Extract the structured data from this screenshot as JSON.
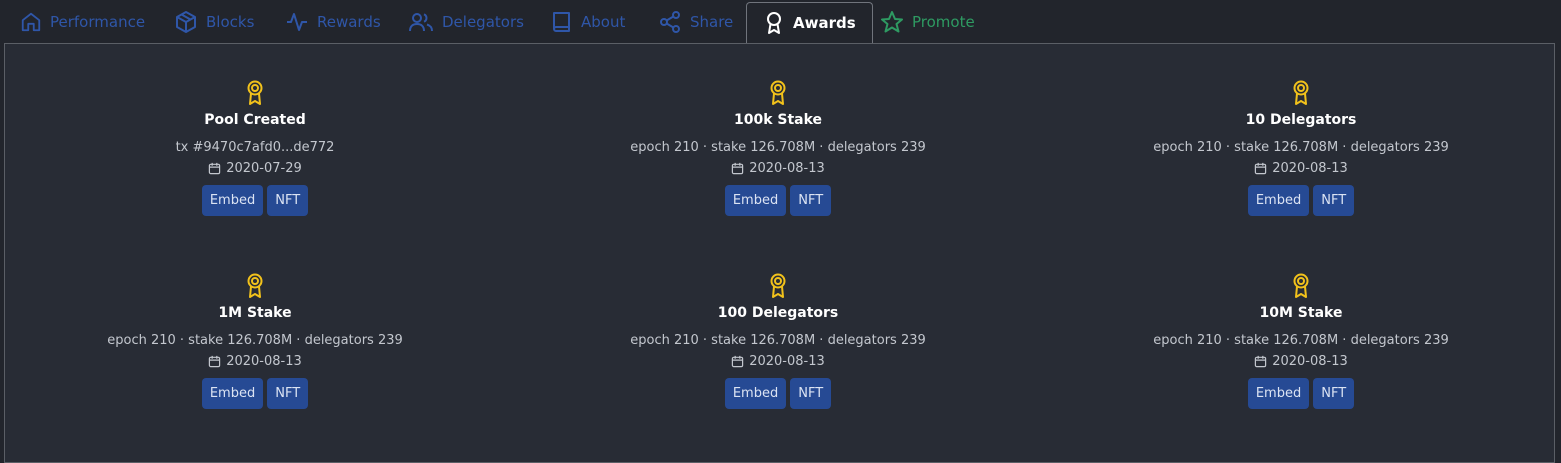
{
  "tabs": [
    {
      "label": "Performance",
      "icon": "home-icon"
    },
    {
      "label": "Blocks",
      "icon": "cube-icon"
    },
    {
      "label": "Rewards",
      "icon": "activity-icon"
    },
    {
      "label": "Delegators",
      "icon": "users-icon"
    },
    {
      "label": "About",
      "icon": "book-icon"
    },
    {
      "label": "Share",
      "icon": "share-icon"
    },
    {
      "label": "Awards",
      "icon": "award-icon",
      "active": true
    },
    {
      "label": "Promote",
      "icon": "star-icon"
    }
  ],
  "colors": {
    "tab_text": "#2f56a8",
    "promote": "#2e9a62",
    "medal": "#f2c21b",
    "button_bg": "#264a94",
    "background": "#22252c"
  },
  "awards": [
    {
      "title": "Pool Created",
      "meta": "tx #9470c7afd0...de772",
      "date": "2020-07-29",
      "embed": "Embed",
      "nft": "NFT"
    },
    {
      "title": "100k Stake",
      "meta": "epoch 210 · stake 126.708M · delegators 239",
      "date": "2020-08-13",
      "embed": "Embed",
      "nft": "NFT"
    },
    {
      "title": "10 Delegators",
      "meta": "epoch 210 · stake 126.708M · delegators 239",
      "date": "2020-08-13",
      "embed": "Embed",
      "nft": "NFT"
    },
    {
      "title": "1M Stake",
      "meta": "epoch 210 · stake 126.708M · delegators 239",
      "date": "2020-08-13",
      "embed": "Embed",
      "nft": "NFT"
    },
    {
      "title": "100 Delegators",
      "meta": "epoch 210 · stake 126.708M · delegators 239",
      "date": "2020-08-13",
      "embed": "Embed",
      "nft": "NFT"
    },
    {
      "title": "10M Stake",
      "meta": "epoch 210 · stake 126.708M · delegators 239",
      "date": "2020-08-13",
      "embed": "Embed",
      "nft": "NFT"
    }
  ]
}
